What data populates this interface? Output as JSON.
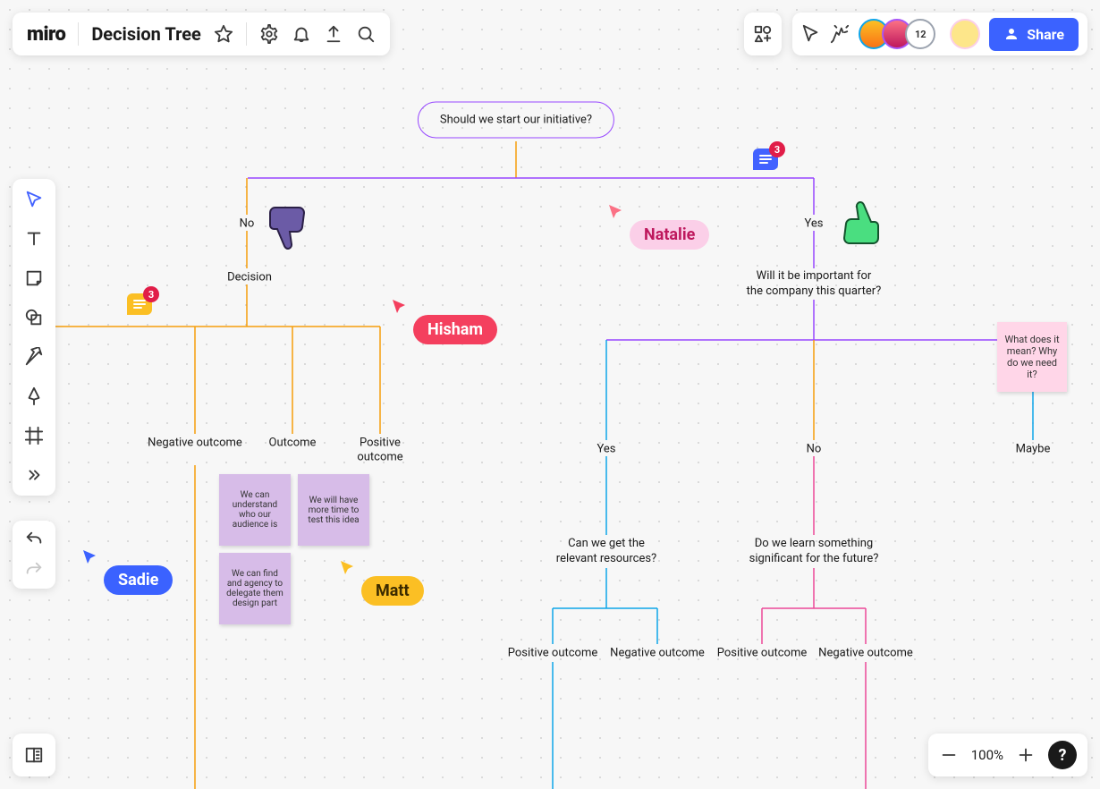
{
  "app": {
    "logo": "miro",
    "board_name": "Decision Tree"
  },
  "toolbar_icons": [
    "select",
    "text",
    "sticky-note",
    "shape",
    "connection-line",
    "pen",
    "frame",
    "more"
  ],
  "collaborators": {
    "overflow_count": "12"
  },
  "share": {
    "label": "Share"
  },
  "zoom": {
    "level": "100%"
  },
  "help": {
    "label": "?"
  },
  "cursors": {
    "sadie": {
      "name": "Sadie",
      "color": "#3b62ff"
    },
    "matt": {
      "name": "Matt",
      "color": "#fbbf24"
    },
    "hisham": {
      "name": "Hisham",
      "color": "#f43f5e"
    },
    "natalie": {
      "name": "Natalie",
      "color": "#f9a8d4",
      "text": "#be185d"
    }
  },
  "comments": {
    "c1": {
      "count": "3"
    },
    "c2": {
      "count": "3"
    }
  },
  "tree": {
    "root": "Should we start our initiative?",
    "no": "No",
    "yes": "Yes",
    "decision": "Decision",
    "important": "Will it be important for\nthe company this quarter?",
    "neg_outcome": "Negative outcome",
    "outcome": "Outcome",
    "pos_outcome": "Positive\noutcome",
    "yes2": "Yes",
    "no2": "No",
    "maybe": "Maybe",
    "resources": "Can we get the\nrelevant resources?",
    "learn": "Do we learn something\nsignificant for the future?",
    "pos_outcome2": "Positive outcome",
    "neg_outcome2": "Negative outcome",
    "pos_outcome3": "Positive outcome",
    "neg_outcome3": "Negative outcome"
  },
  "stickies": {
    "s1": "We can understand who our audience is",
    "s2": "We will have more time to test this idea",
    "s3": "We can find and agency to delegate them design part",
    "s4": "What does it mean? Why do we need it?"
  }
}
